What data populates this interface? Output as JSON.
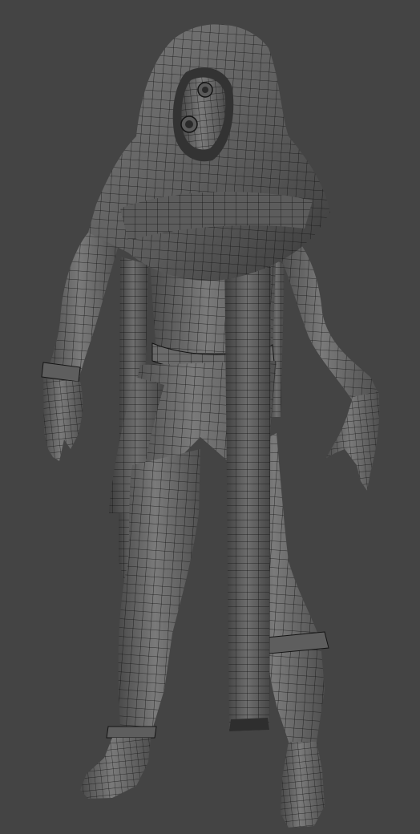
{
  "viewport": {
    "background_color": "#444444",
    "mode": "wireframe-on-shaded",
    "subject": "hooded-character-mesh"
  },
  "colors": {
    "mesh_fill": "#6b6b6b",
    "mesh_fill_dark": "#3c3c3c",
    "mesh_fill_light": "#8c8c8c",
    "wire": "#141414"
  }
}
